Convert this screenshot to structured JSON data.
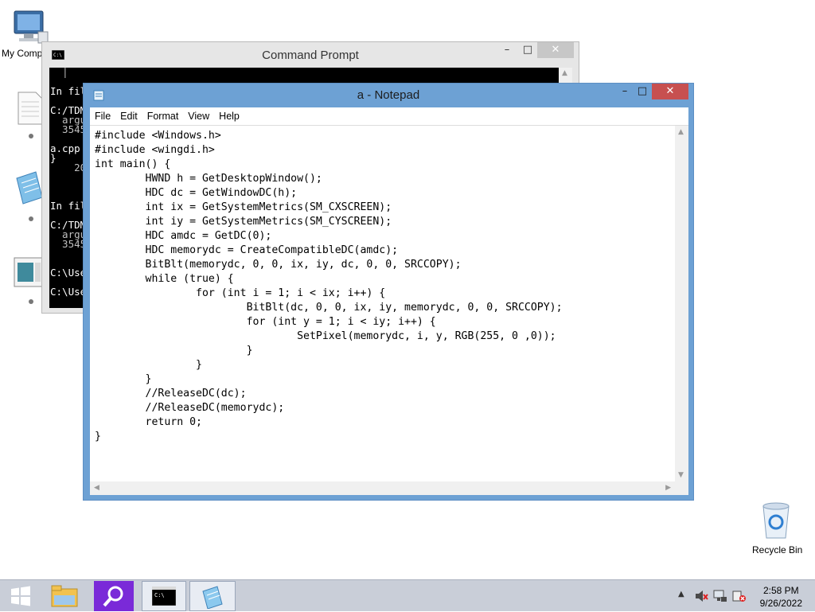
{
  "desktop": {
    "icons": [
      {
        "label": "My Computer"
      },
      {
        "label": "Recycle Bin"
      }
    ]
  },
  "cmd": {
    "title": "Command Prompt",
    "console_lines": [
      "  │",
      "",
      "In fil",
      "",
      "C:/TDM",
      "  argu",
      "  3545",
      "",
      "a.cpp",
      "}",
      "    20",
      "",
      "",
      "",
      "In fil",
      "",
      "C:/TDM",
      "  argu",
      "  3545",
      "",
      "",
      "C:\\Use",
      "",
      "C:\\Use"
    ]
  },
  "notepad": {
    "title": "a - Notepad",
    "menu": [
      "File",
      "Edit",
      "Format",
      "View",
      "Help"
    ],
    "content": "#include <Windows.h>\n#include <wingdi.h>\nint main() {\n\tHWND h = GetDesktopWindow();\n\tHDC dc = GetWindowDC(h);\n\tint ix = GetSystemMetrics(SM_CXSCREEN);\n\tint iy = GetSystemMetrics(SM_CYSCREEN);\n\tHDC amdc = GetDC(0);\n\tHDC memorydc = CreateCompatibleDC(amdc);\n\tBitBlt(memorydc, 0, 0, ix, iy, dc, 0, 0, SRCCOPY);\n\twhile (true) {\n\t\tfor (int i = 1; i < ix; i++) {\n\t\t\tBitBlt(dc, 0, 0, ix, iy, memorydc, 0, 0, SRCCOPY);\n\t\t\tfor (int y = 1; i < iy; i++) {\n\t\t\t\tSetPixel(memorydc, i, y, RGB(255, 0 ,0));\n\t\t\t}\n\t\t}\n\t}\n\t//ReleaseDC(dc);\n\t//ReleaseDC(memorydc);\n\treturn 0;\n}"
  },
  "taskbar": {
    "time": "2:58 PM",
    "date": "9/26/2022"
  },
  "colors": {
    "notepad_frame": "#6da1d4",
    "close_button": "#c75050",
    "taskbar": "#c9ced8",
    "search_app": "#7a2ad8"
  }
}
